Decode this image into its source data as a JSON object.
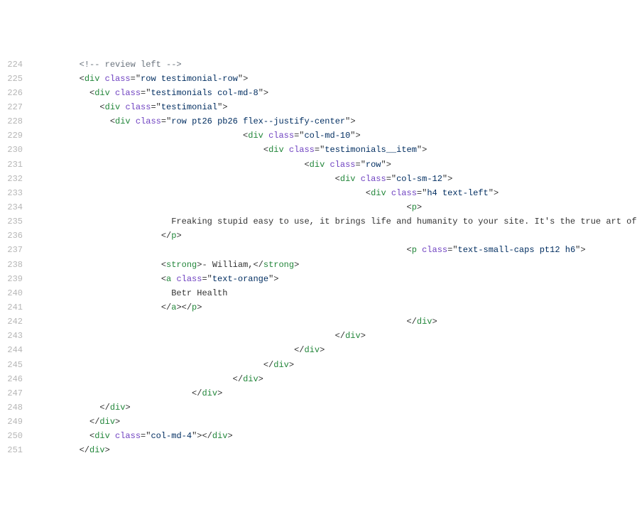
{
  "lines": [
    {
      "num": 224,
      "indent": 8,
      "segs": [
        {
          "cls": "comment",
          "t": "<!-- review left -->"
        }
      ]
    },
    {
      "num": 225,
      "indent": 8,
      "segs": [
        {
          "cls": "punct",
          "t": "<"
        },
        {
          "cls": "tag",
          "t": "div"
        },
        {
          "cls": "text",
          "t": " "
        },
        {
          "cls": "attr-name",
          "t": "class"
        },
        {
          "cls": "punct",
          "t": "="
        },
        {
          "cls": "punct",
          "t": "\""
        },
        {
          "cls": "attr-val",
          "t": "row testimonial-row"
        },
        {
          "cls": "punct",
          "t": "\""
        },
        {
          "cls": "punct",
          "t": ">"
        }
      ]
    },
    {
      "num": 226,
      "indent": 10,
      "segs": [
        {
          "cls": "punct",
          "t": "<"
        },
        {
          "cls": "tag",
          "t": "div"
        },
        {
          "cls": "text",
          "t": " "
        },
        {
          "cls": "attr-name",
          "t": "class"
        },
        {
          "cls": "punct",
          "t": "="
        },
        {
          "cls": "punct",
          "t": "\""
        },
        {
          "cls": "attr-val",
          "t": "testimonials col-md-8"
        },
        {
          "cls": "punct",
          "t": "\""
        },
        {
          "cls": "punct",
          "t": ">"
        }
      ]
    },
    {
      "num": 227,
      "indent": 12,
      "segs": [
        {
          "cls": "punct",
          "t": "<"
        },
        {
          "cls": "tag",
          "t": "div"
        },
        {
          "cls": "text",
          "t": " "
        },
        {
          "cls": "attr-name",
          "t": "class"
        },
        {
          "cls": "punct",
          "t": "="
        },
        {
          "cls": "punct",
          "t": "\""
        },
        {
          "cls": "attr-val",
          "t": "testimonial"
        },
        {
          "cls": "punct",
          "t": "\""
        },
        {
          "cls": "punct",
          "t": ">"
        }
      ]
    },
    {
      "num": 228,
      "indent": 14,
      "segs": [
        {
          "cls": "punct",
          "t": "<"
        },
        {
          "cls": "tag",
          "t": "div"
        },
        {
          "cls": "text",
          "t": " "
        },
        {
          "cls": "attr-name",
          "t": "class"
        },
        {
          "cls": "punct",
          "t": "="
        },
        {
          "cls": "punct",
          "t": "\""
        },
        {
          "cls": "attr-val",
          "t": "row pt26 pb26 flex--justify-center"
        },
        {
          "cls": "punct",
          "t": "\""
        },
        {
          "cls": "punct",
          "t": ">"
        }
      ]
    },
    {
      "num": 229,
      "indent": 40,
      "segs": [
        {
          "cls": "punct",
          "t": "<"
        },
        {
          "cls": "tag",
          "t": "div"
        },
        {
          "cls": "text",
          "t": " "
        },
        {
          "cls": "attr-name",
          "t": "class"
        },
        {
          "cls": "punct",
          "t": "="
        },
        {
          "cls": "punct",
          "t": "\""
        },
        {
          "cls": "attr-val",
          "t": "col-md-10"
        },
        {
          "cls": "punct",
          "t": "\""
        },
        {
          "cls": "punct",
          "t": ">"
        }
      ]
    },
    {
      "num": 230,
      "indent": 44,
      "segs": [
        {
          "cls": "punct",
          "t": "<"
        },
        {
          "cls": "tag",
          "t": "div"
        },
        {
          "cls": "text",
          "t": " "
        },
        {
          "cls": "attr-name",
          "t": "class"
        },
        {
          "cls": "punct",
          "t": "="
        },
        {
          "cls": "punct",
          "t": "\""
        },
        {
          "cls": "attr-val",
          "t": "testimonials__item"
        },
        {
          "cls": "punct",
          "t": "\""
        },
        {
          "cls": "punct",
          "t": ">"
        }
      ]
    },
    {
      "num": 231,
      "indent": 52,
      "segs": [
        {
          "cls": "punct",
          "t": "<"
        },
        {
          "cls": "tag",
          "t": "div"
        },
        {
          "cls": "text",
          "t": " "
        },
        {
          "cls": "attr-name",
          "t": "class"
        },
        {
          "cls": "punct",
          "t": "="
        },
        {
          "cls": "punct",
          "t": "\""
        },
        {
          "cls": "attr-val",
          "t": "row"
        },
        {
          "cls": "punct",
          "t": "\""
        },
        {
          "cls": "punct",
          "t": ">"
        }
      ]
    },
    {
      "num": 232,
      "indent": 58,
      "segs": [
        {
          "cls": "punct",
          "t": "<"
        },
        {
          "cls": "tag",
          "t": "div"
        },
        {
          "cls": "text",
          "t": " "
        },
        {
          "cls": "attr-name",
          "t": "class"
        },
        {
          "cls": "punct",
          "t": "="
        },
        {
          "cls": "punct",
          "t": "\""
        },
        {
          "cls": "attr-val",
          "t": "col-sm-12"
        },
        {
          "cls": "punct",
          "t": "\""
        },
        {
          "cls": "punct",
          "t": ">"
        }
      ]
    },
    {
      "num": 233,
      "indent": 64,
      "segs": [
        {
          "cls": "punct",
          "t": "<"
        },
        {
          "cls": "tag",
          "t": "div"
        },
        {
          "cls": "text",
          "t": " "
        },
        {
          "cls": "attr-name",
          "t": "class"
        },
        {
          "cls": "punct",
          "t": "="
        },
        {
          "cls": "punct",
          "t": "\""
        },
        {
          "cls": "attr-val",
          "t": "h4 text-left"
        },
        {
          "cls": "punct",
          "t": "\""
        },
        {
          "cls": "punct",
          "t": ">"
        }
      ]
    },
    {
      "num": 234,
      "indent": 72,
      "segs": [
        {
          "cls": "punct",
          "t": "<"
        },
        {
          "cls": "tag",
          "t": "p"
        },
        {
          "cls": "punct",
          "t": ">"
        }
      ]
    },
    {
      "num": 235,
      "indent": 26,
      "segs": [
        {
          "cls": "text",
          "t": "Freaking stupid easy to use, it brings life and humanity to your site. It's the true art of"
        }
      ]
    },
    {
      "num": 236,
      "indent": 24,
      "segs": [
        {
          "cls": "punct",
          "t": "</"
        },
        {
          "cls": "tag",
          "t": "p"
        },
        {
          "cls": "punct",
          "t": ">"
        }
      ]
    },
    {
      "num": 237,
      "indent": 72,
      "segs": [
        {
          "cls": "punct",
          "t": "<"
        },
        {
          "cls": "tag",
          "t": "p"
        },
        {
          "cls": "text",
          "t": " "
        },
        {
          "cls": "attr-name",
          "t": "class"
        },
        {
          "cls": "punct",
          "t": "="
        },
        {
          "cls": "punct",
          "t": "\""
        },
        {
          "cls": "attr-val",
          "t": "text-small-caps pt12 h6"
        },
        {
          "cls": "punct",
          "t": "\""
        },
        {
          "cls": "punct",
          "t": ">"
        }
      ]
    },
    {
      "num": 238,
      "indent": 24,
      "segs": [
        {
          "cls": "punct",
          "t": "<"
        },
        {
          "cls": "tag",
          "t": "strong"
        },
        {
          "cls": "punct",
          "t": ">"
        },
        {
          "cls": "text",
          "t": "- William,"
        },
        {
          "cls": "punct",
          "t": "</"
        },
        {
          "cls": "tag",
          "t": "strong"
        },
        {
          "cls": "punct",
          "t": ">"
        }
      ]
    },
    {
      "num": 239,
      "indent": 24,
      "segs": [
        {
          "cls": "punct",
          "t": "<"
        },
        {
          "cls": "tag",
          "t": "a"
        },
        {
          "cls": "text",
          "t": " "
        },
        {
          "cls": "attr-name",
          "t": "class"
        },
        {
          "cls": "punct",
          "t": "="
        },
        {
          "cls": "punct",
          "t": "\""
        },
        {
          "cls": "attr-val",
          "t": "text-orange"
        },
        {
          "cls": "punct",
          "t": "\""
        },
        {
          "cls": "punct",
          "t": ">"
        }
      ]
    },
    {
      "num": 240,
      "indent": 26,
      "segs": [
        {
          "cls": "text",
          "t": "Betr Health"
        }
      ]
    },
    {
      "num": 241,
      "indent": 24,
      "segs": [
        {
          "cls": "punct",
          "t": "</"
        },
        {
          "cls": "tag",
          "t": "a"
        },
        {
          "cls": "punct",
          "t": ">"
        },
        {
          "cls": "punct",
          "t": "</"
        },
        {
          "cls": "tag",
          "t": "p"
        },
        {
          "cls": "punct",
          "t": ">"
        }
      ]
    },
    {
      "num": 242,
      "indent": 72,
      "segs": [
        {
          "cls": "punct",
          "t": "</"
        },
        {
          "cls": "tag",
          "t": "div"
        },
        {
          "cls": "punct",
          "t": ">"
        }
      ]
    },
    {
      "num": 243,
      "indent": 58,
      "segs": [
        {
          "cls": "punct",
          "t": "</"
        },
        {
          "cls": "tag",
          "t": "div"
        },
        {
          "cls": "punct",
          "t": ">"
        }
      ]
    },
    {
      "num": 244,
      "indent": 50,
      "segs": [
        {
          "cls": "punct",
          "t": "</"
        },
        {
          "cls": "tag",
          "t": "div"
        },
        {
          "cls": "punct",
          "t": ">"
        }
      ]
    },
    {
      "num": 245,
      "indent": 44,
      "segs": [
        {
          "cls": "punct",
          "t": "</"
        },
        {
          "cls": "tag",
          "t": "div"
        },
        {
          "cls": "punct",
          "t": ">"
        }
      ]
    },
    {
      "num": 246,
      "indent": 38,
      "segs": [
        {
          "cls": "punct",
          "t": "</"
        },
        {
          "cls": "tag",
          "t": "div"
        },
        {
          "cls": "punct",
          "t": ">"
        }
      ]
    },
    {
      "num": 247,
      "indent": 30,
      "segs": [
        {
          "cls": "punct",
          "t": "</"
        },
        {
          "cls": "tag",
          "t": "div"
        },
        {
          "cls": "punct",
          "t": ">"
        }
      ]
    },
    {
      "num": 248,
      "indent": 12,
      "segs": [
        {
          "cls": "punct",
          "t": "</"
        },
        {
          "cls": "tag",
          "t": "div"
        },
        {
          "cls": "punct",
          "t": ">"
        }
      ]
    },
    {
      "num": 249,
      "indent": 10,
      "segs": [
        {
          "cls": "punct",
          "t": "</"
        },
        {
          "cls": "tag",
          "t": "div"
        },
        {
          "cls": "punct",
          "t": ">"
        }
      ]
    },
    {
      "num": 250,
      "indent": 10,
      "segs": [
        {
          "cls": "punct",
          "t": "<"
        },
        {
          "cls": "tag",
          "t": "div"
        },
        {
          "cls": "text",
          "t": " "
        },
        {
          "cls": "attr-name",
          "t": "class"
        },
        {
          "cls": "punct",
          "t": "="
        },
        {
          "cls": "punct",
          "t": "\""
        },
        {
          "cls": "attr-val",
          "t": "col-md-4"
        },
        {
          "cls": "punct",
          "t": "\""
        },
        {
          "cls": "punct",
          "t": ">"
        },
        {
          "cls": "punct",
          "t": "</"
        },
        {
          "cls": "tag",
          "t": "div"
        },
        {
          "cls": "punct",
          "t": ">"
        }
      ]
    },
    {
      "num": 251,
      "indent": 8,
      "segs": [
        {
          "cls": "punct",
          "t": "</"
        },
        {
          "cls": "tag",
          "t": "div"
        },
        {
          "cls": "punct",
          "t": ">"
        }
      ]
    }
  ]
}
